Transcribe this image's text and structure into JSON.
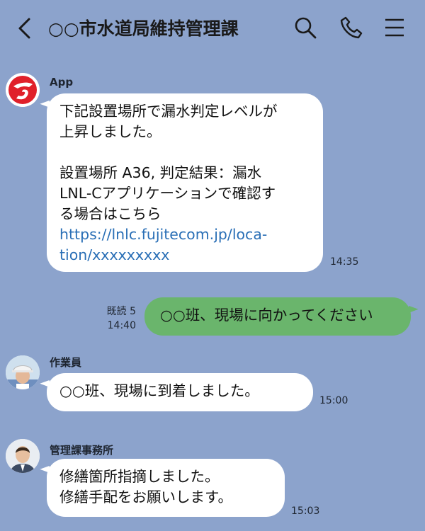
{
  "header": {
    "title": "○○市水道局維持管理課",
    "icons": [
      "back-icon",
      "search-icon",
      "phone-icon",
      "menu-icon"
    ]
  },
  "messages": [
    {
      "sender": "App",
      "lines": [
        "下記設置場所で漏水判定レベルが",
        "上昇しました。",
        "",
        "設置場所 A36, 判定結果：漏水",
        "LNL-Cアプリケーションで確認す",
        "る場合はこちら"
      ],
      "link_lines": [
        "https://lnlc.fujitecom.jp/loca-",
        "tion/xxxxxxxxx"
      ],
      "time": "14:35"
    },
    {
      "own": true,
      "text": "○○班、現場に向かってください",
      "read": "既読 5",
      "time": "14:40"
    },
    {
      "sender": "作業員",
      "text": "○○班、現場に到着しました。",
      "time": "15:00"
    },
    {
      "sender": "管理課事務所",
      "lines": [
        "修繕箇所指摘しました。",
        "修繕手配をお願いします。"
      ],
      "time": "15:03"
    }
  ],
  "colors": {
    "background": "#8ca3cc",
    "own_bubble": "#6ab56c",
    "link": "#2a6fb6",
    "app_logo": "#e0202a"
  }
}
